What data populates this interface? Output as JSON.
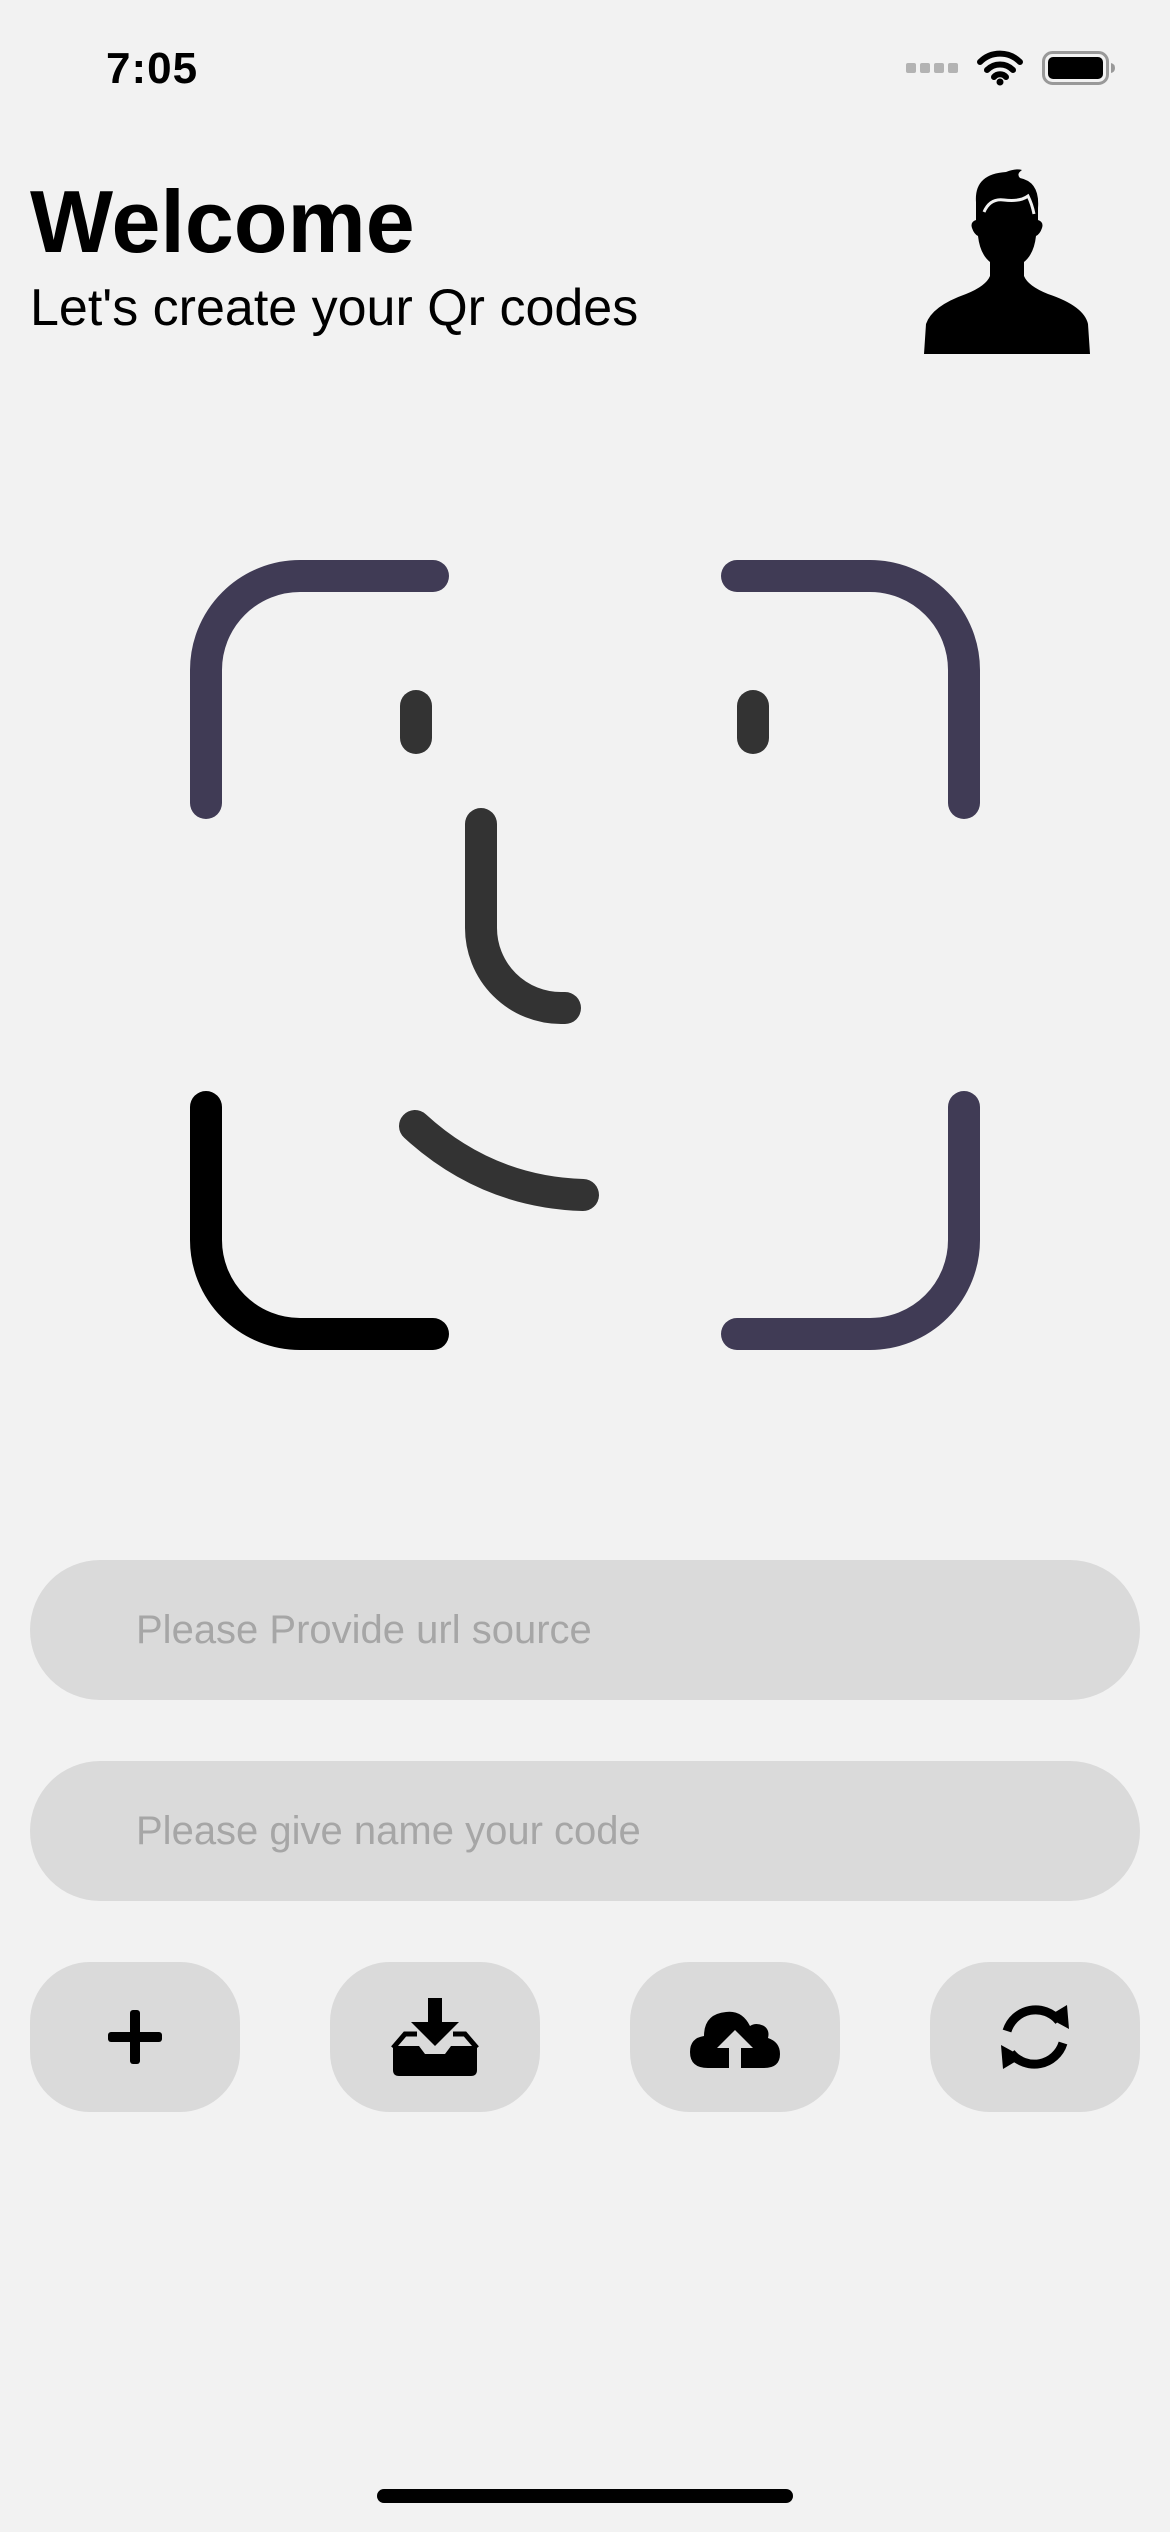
{
  "status_bar": {
    "time": "7:05",
    "icons": [
      "cellular-signal-icon",
      "wifi-icon",
      "battery-icon"
    ]
  },
  "header": {
    "title": "Welcome",
    "subtitle": "Let's create your Qr codes",
    "avatar_icon": "user-silhouette-icon"
  },
  "scanner": {
    "icon": "face-id-icon",
    "colors": {
      "frame": "#403b55",
      "frame_bottom_left": "#000000",
      "face_features": "#333333"
    }
  },
  "form": {
    "url_placeholder": "Please Provide url source",
    "url_value": "",
    "name_placeholder": "Please give name your code",
    "name_value": ""
  },
  "actions": [
    {
      "icon": "plus-icon"
    },
    {
      "icon": "download-tray-icon"
    },
    {
      "icon": "cloud-upload-icon"
    },
    {
      "icon": "refresh-icon"
    }
  ],
  "colors": {
    "background": "#f2f2f2",
    "field_background": "#dadada",
    "placeholder": "#a6a6a6"
  }
}
